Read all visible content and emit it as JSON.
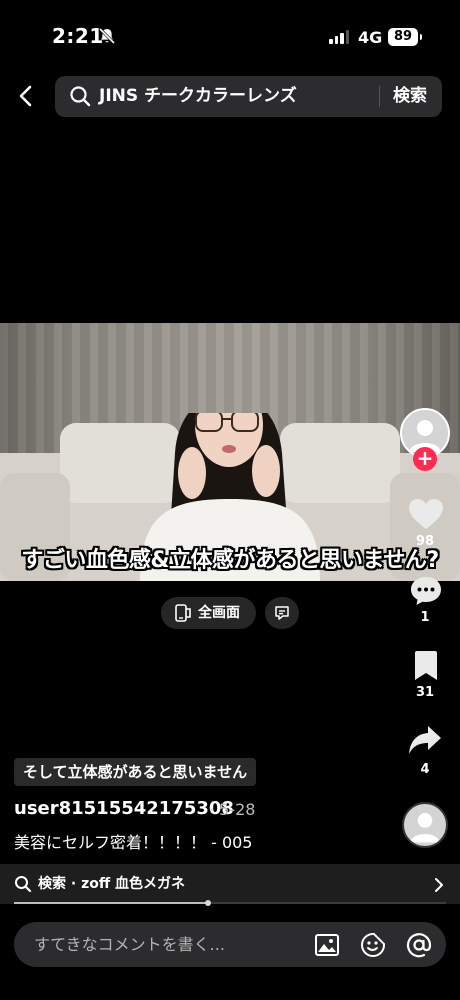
{
  "status_bar": {
    "time": "2:21",
    "network": "4G",
    "battery": "89",
    "signal_level": 3,
    "silent_icon": "bell-slash-icon"
  },
  "search": {
    "query": "JINS チークカラーレンズ",
    "button_label": "検索",
    "back_icon": "chevron-left-icon",
    "search_icon": "search-icon"
  },
  "video": {
    "caption": "すごい血色感&立体感があると思いません?"
  },
  "controls": {
    "fullscreen_label": "全画面",
    "fullscreen_icon": "fullscreen-icon",
    "subtitle_icon": "subtitle-icon"
  },
  "rail": {
    "likes": "98",
    "comments": "1",
    "saves": "31",
    "shares": "4",
    "follow_symbol": "+",
    "accent": "#fe2c55"
  },
  "info": {
    "tag": "そして立体感があると思いません",
    "username": "user81515542175308",
    "date": "· 5-28",
    "description": "美容にセルフ密着！！！！ - 005"
  },
  "related_search": {
    "label": "検索 · zoff 血色メガネ",
    "search_icon": "search-icon",
    "chevron_icon": "chevron-right-icon"
  },
  "playback": {
    "progress_fraction": 0.45
  },
  "comment_bar": {
    "placeholder": "すてきなコメントを書く...",
    "image_icon": "image-icon",
    "emoji_icon": "emoji-icon",
    "mention_icon": "at-sign-icon"
  }
}
